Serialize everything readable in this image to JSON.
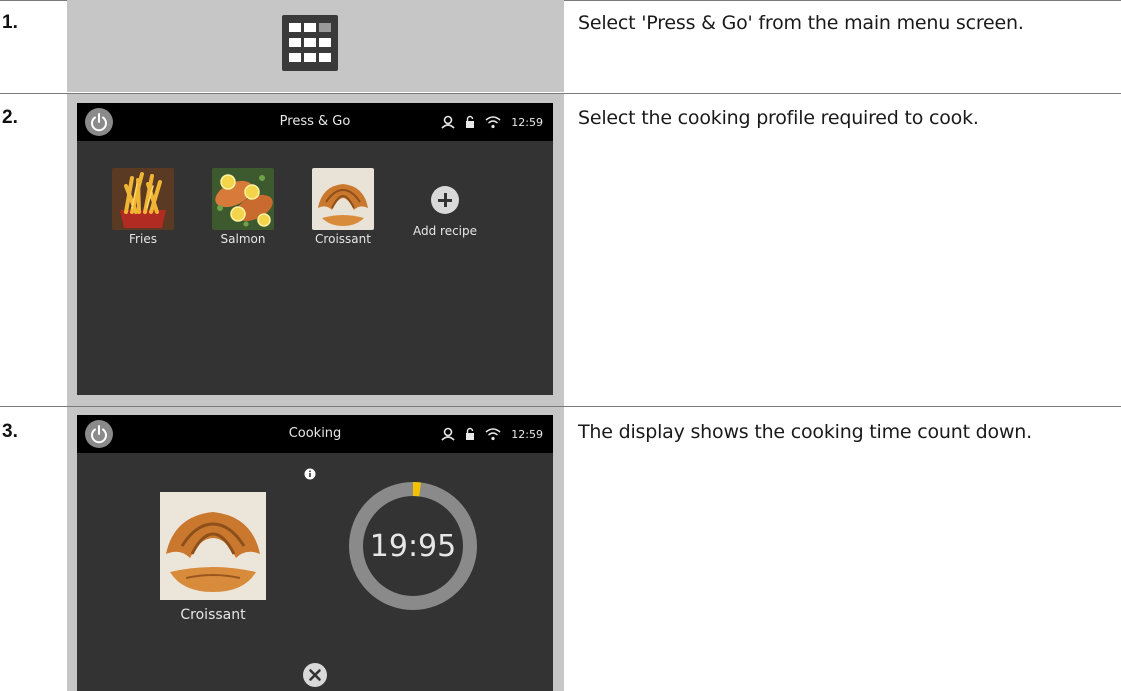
{
  "steps": [
    {
      "number": "1.",
      "text": "Select 'Press & Go' from the main menu screen."
    },
    {
      "number": "2.",
      "text": "Select the cooking profile required to cook."
    },
    {
      "number": "3.",
      "text": "The display shows the cooking time count down."
    }
  ],
  "screen_press_go": {
    "title": "Press & Go",
    "time": "12:59",
    "recipes": [
      {
        "label": "Fries"
      },
      {
        "label": "Salmon"
      },
      {
        "label": "Croissant"
      }
    ],
    "add_label": "Add recipe"
  },
  "screen_cooking": {
    "title": "Cooking",
    "time": "12:59",
    "recipe_label": "Croissant",
    "timer": "19:95",
    "progress_fraction": 0.02
  },
  "colors": {
    "cell_bg": "#c6c6c6",
    "screen_bg": "#333333",
    "topbar_bg": "#000000",
    "progress_accent": "#f2c200",
    "ring": "#8a8a8a"
  },
  "icons": [
    "grid-menu-icon",
    "power-icon",
    "user-icon",
    "lock-icon",
    "wifi-icon",
    "add-icon",
    "info-icon",
    "close-icon"
  ]
}
